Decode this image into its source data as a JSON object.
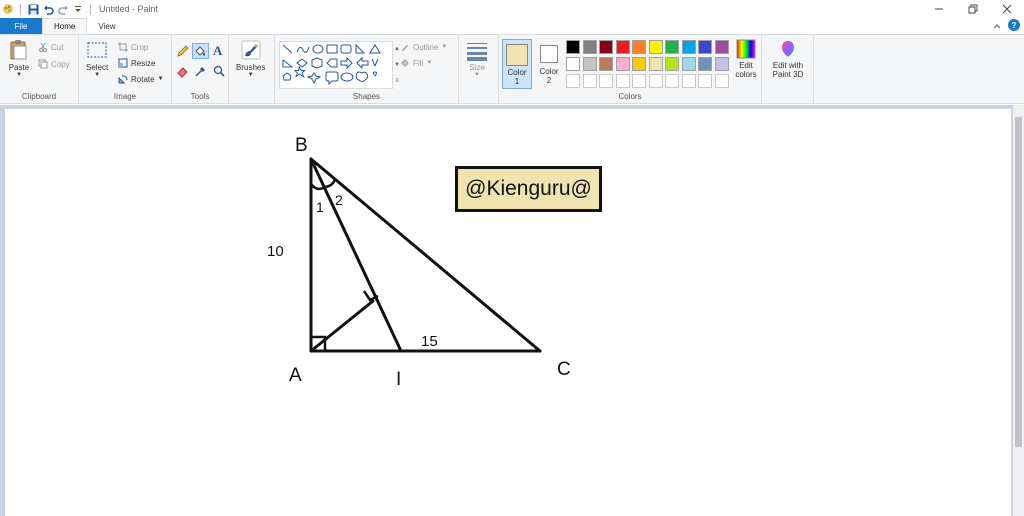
{
  "title_bar": {
    "title": "Untitled - Paint"
  },
  "tabs": {
    "file": "File",
    "home": "Home",
    "view": "View"
  },
  "clipboard": {
    "paste": "Paste",
    "cut": "Cut",
    "copy": "Copy",
    "label": "Clipboard"
  },
  "image": {
    "select": "Select",
    "crop": "Crop",
    "resize": "Resize",
    "rotate": "Rotate",
    "label": "Image"
  },
  "tools": {
    "label": "Tools",
    "text_tool": "A"
  },
  "brushes": {
    "label": "Brushes"
  },
  "shapes": {
    "outline": "Outline",
    "fill": "Fill",
    "label": "Shapes"
  },
  "size": {
    "label": "Size"
  },
  "colors": {
    "color1_label": "Color",
    "color1_num": "1",
    "color2_label": "Color",
    "color2_num": "2",
    "edit_colors": "Edit",
    "edit_colors_2": "colors",
    "paint3d": "Edit with",
    "paint3d_2": "Paint 3D",
    "label": "Colors",
    "color1_value": "#efe4b0",
    "color2_value": "#ffffff",
    "palette_row1": [
      "#000000",
      "#7f7f7f",
      "#880015",
      "#ed1c24",
      "#ff7f27",
      "#fff200",
      "#22b14c",
      "#00a2e8",
      "#3f48cc",
      "#a349a4"
    ],
    "palette_row2": [
      "#ffffff",
      "#c3c3c3",
      "#b97a57",
      "#ffaec9",
      "#ffc90e",
      "#efe4b0",
      "#b5e61d",
      "#99d9ea",
      "#7092be",
      "#c8bfe7"
    ]
  },
  "drawing": {
    "vertex_b": "B",
    "vertex_a": "A",
    "vertex_c": "C",
    "vertex_i": "I",
    "side_ab": "10",
    "side_ic": "15",
    "angle_1": "1",
    "angle_2": "2",
    "watermark": "@Kienguru@",
    "watermark_bg": "#efe4b0"
  }
}
